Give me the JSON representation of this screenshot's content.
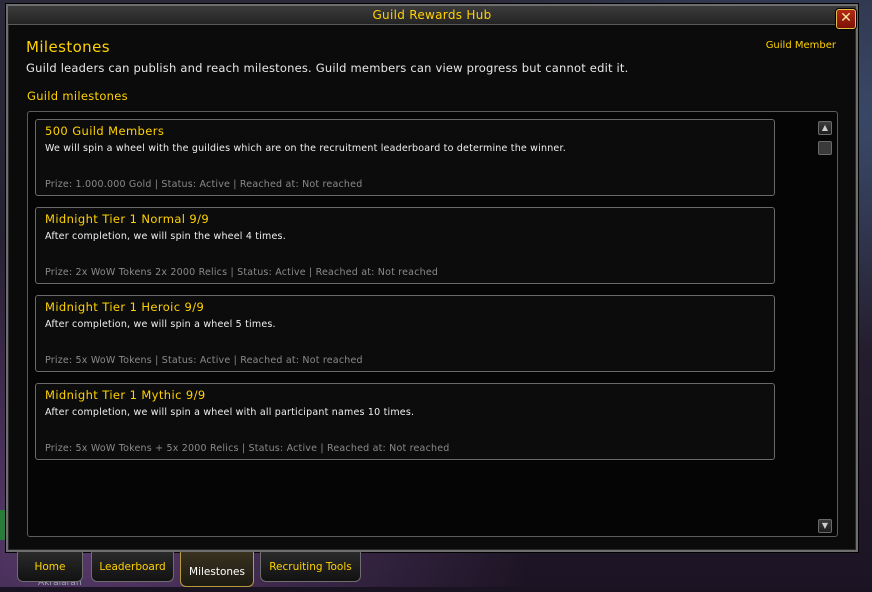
{
  "window": {
    "title": "Guild Rewards Hub"
  },
  "header": {
    "title": "Milestones",
    "role": "Guild Member",
    "description": "Guild leaders can publish and reach milestones. Guild members can view progress but cannot edit it."
  },
  "section": {
    "label": "Guild milestones"
  },
  "milestones": [
    {
      "title": "500 Guild Members",
      "description": "We will spin a wheel with the guildies which are on the recruitment leaderboard to determine the winner.",
      "meta": "Prize: 1.000.000 Gold | Status: Active | Reached at: Not reached"
    },
    {
      "title": "Midnight Tier 1 Normal 9/9",
      "description": "After completion, we will spin the wheel 4 times.",
      "meta": "Prize: 2x WoW Tokens 2x 2000 Relics | Status: Active | Reached at: Not reached"
    },
    {
      "title": "Midnight Tier 1 Heroic 9/9",
      "description": "After completion, we will spin a wheel 5 times.",
      "meta": "Prize: 5x WoW Tokens | Status: Active | Reached at: Not reached"
    },
    {
      "title": "Midnight Tier 1 Mythic 9/9",
      "description": "After completion, we will spin a wheel with all participant names 10 times.",
      "meta": "Prize: 5x WoW Tokens + 5x 2000 Relics | Status: Active | Reached at: Not reached"
    }
  ],
  "tabs": [
    {
      "label": "Home",
      "active": false
    },
    {
      "label": "Leaderboard",
      "active": false
    },
    {
      "label": "Milestones",
      "active": true
    },
    {
      "label": "Recruiting Tools",
      "active": false
    }
  ],
  "background": {
    "player_name": "Akralaran"
  },
  "icons": {
    "close": "close-icon",
    "scroll_up": "scroll-up-icon",
    "scroll_down": "scroll-down-icon"
  },
  "colors": {
    "accent": "#ffd200",
    "text": "#e8e8e8",
    "muted": "#8a8a8a"
  }
}
